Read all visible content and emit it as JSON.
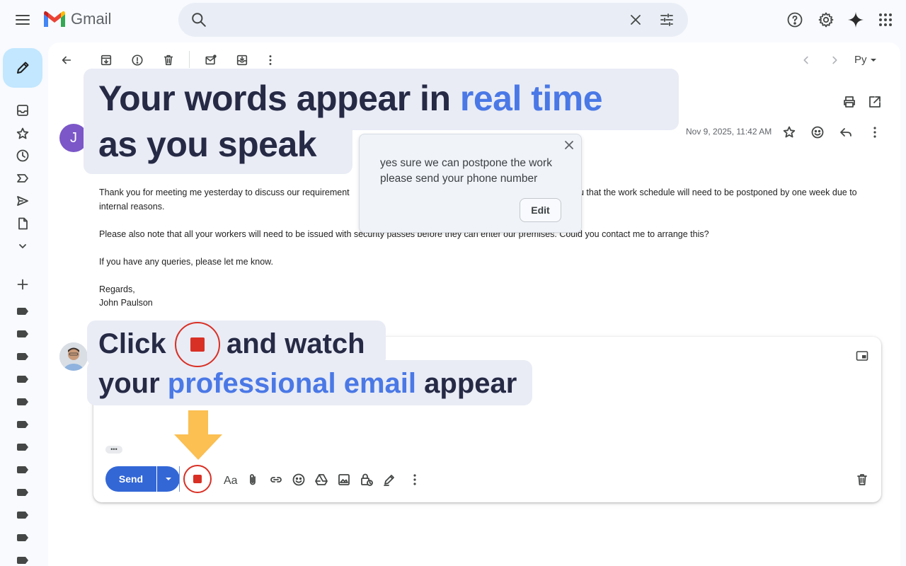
{
  "app": {
    "name": "Gmail"
  },
  "email": {
    "sender_initial": "J",
    "date": "Nov 9, 2025, 11:42 AM",
    "body": [
      "Thank you for meeting me yesterday to discuss our requirement",
      "u that the work schedule will need to be postponed by one week due to",
      "internal reasons.",
      "Please also note that all your workers will need to be issued with security passes before they can enter our premises. Could you contact me to arrange this?",
      "If you have any queries, please let me know.",
      "Regards,",
      "John Paulson"
    ]
  },
  "overlay": {
    "headline_1a": "Your words appear in ",
    "headline_1b": "real time",
    "headline_2": "as you speak",
    "click_a": "Click",
    "click_b": "and watch",
    "line2_a": "your ",
    "line2_b": "professional email",
    "line2_c": " appear"
  },
  "popup": {
    "text": "yes sure we can postpone the work please send your phone number",
    "edit_label": "Edit"
  },
  "compose": {
    "send_label": "Send",
    "more_dots": "•••"
  },
  "toolbar": {
    "input_tool_label": "Pу"
  },
  "colors": {
    "accent": "#4a78e6",
    "send": "#3367d6",
    "record": "#d93025",
    "arrow": "#fbbf52"
  }
}
